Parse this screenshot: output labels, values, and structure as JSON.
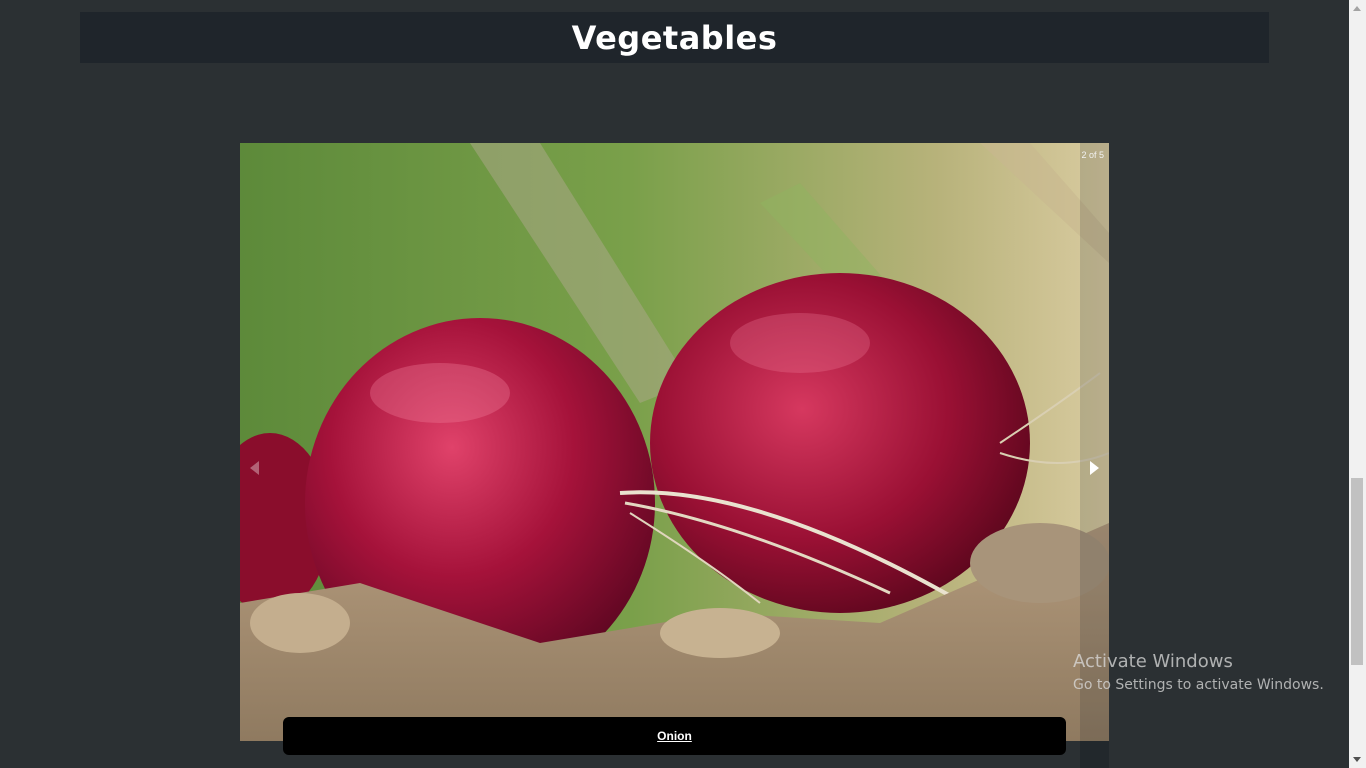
{
  "header": {
    "title": "Vegetables"
  },
  "slideshow": {
    "counter": "2 of 5",
    "current_slide": 2,
    "total_slides": 5,
    "image_subject": "red onions",
    "caption": "Onion",
    "prev_icon": "caret-left-icon",
    "next_icon": "caret-right-icon"
  },
  "watermark": {
    "title": "Activate Windows",
    "subtitle": "Go to Settings to activate Windows."
  },
  "colors": {
    "page_background": "#2b3033",
    "header_background": "#1f252b",
    "caption_background": "#000000",
    "onion_red": "#9c1032"
  }
}
